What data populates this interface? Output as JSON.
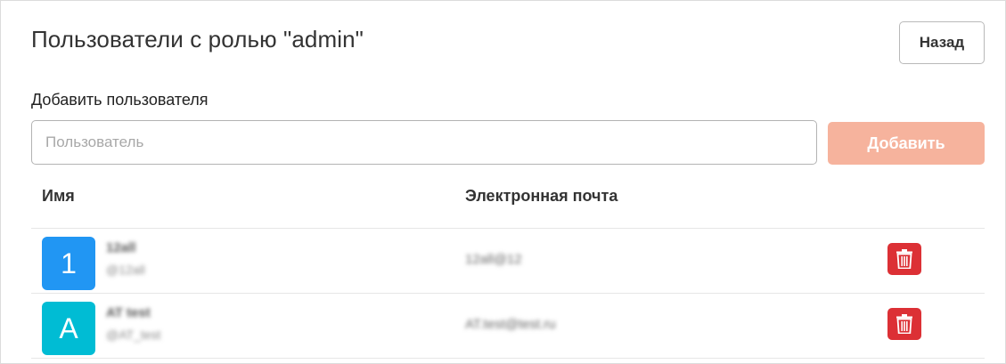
{
  "header": {
    "title": "Пользователи с ролью \"admin\"",
    "back_label": "Назад"
  },
  "add_user": {
    "label": "Добавить пользователя",
    "input_placeholder": "Пользователь",
    "input_value": "",
    "add_label": "Добавить"
  },
  "table": {
    "columns": [
      "Имя",
      "Электронная почта"
    ],
    "rows": [
      {
        "avatar_letter": "1",
        "avatar_color": "#2196f3",
        "name": "12all",
        "login": "@12all",
        "email": "12all@12"
      },
      {
        "avatar_letter": "A",
        "avatar_color": "#00bcd4",
        "name": "AT test",
        "login": "@AT_test",
        "email": "AT.test@test.ru"
      }
    ]
  },
  "colors": {
    "add_button_disabled": "#f6b39d",
    "delete_button": "#dc3035"
  },
  "icons": {
    "delete": "trash-icon"
  }
}
